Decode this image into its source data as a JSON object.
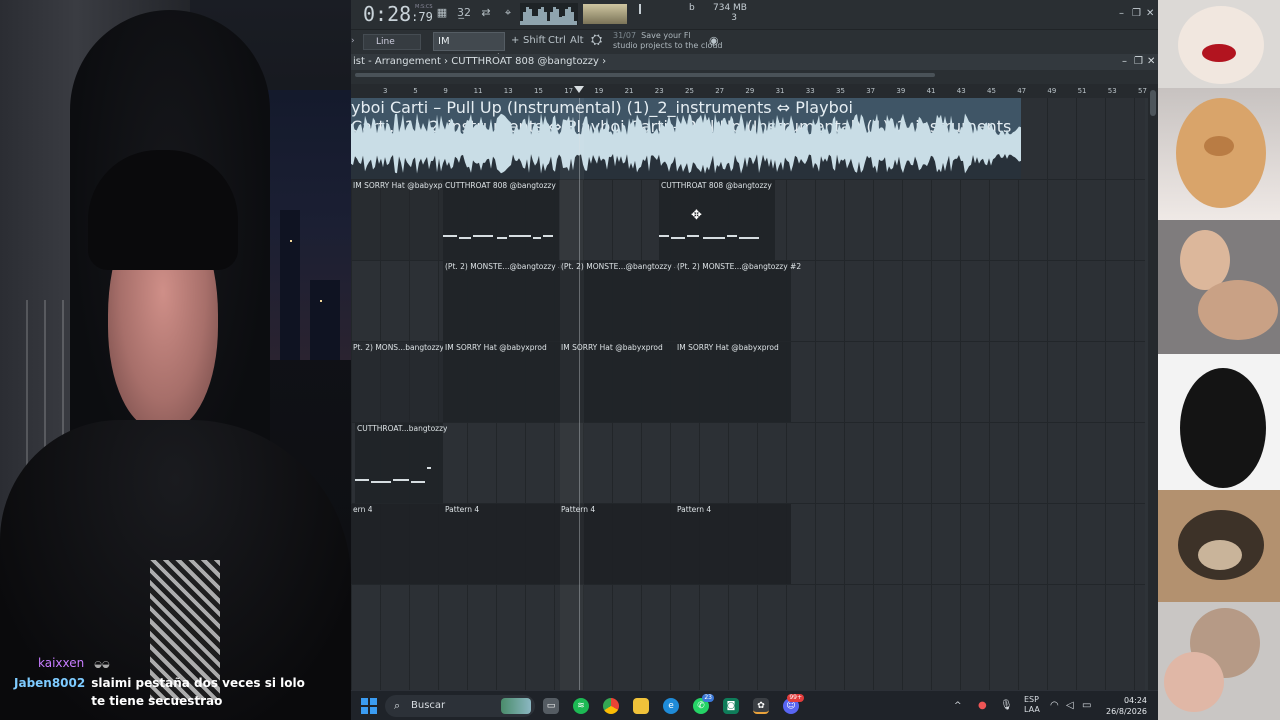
{
  "transport": {
    "time": "0:28",
    "time_ms": "79",
    "time_unit": "M:S:CS"
  },
  "stats": {
    "memory": "734 MB",
    "cpu_count": "3",
    "voices": "b"
  },
  "toolbar": {
    "snap_label": "Line",
    "pattern_selected": "IM SOR..yxprod",
    "modifier_shift": "Shift",
    "modifier_ctrl": "Ctrl",
    "modifier_alt": "Alt",
    "save_note_date": "31/07",
    "save_note_line1": "Save your Fl",
    "save_note_line2": "studio projects to the cloud"
  },
  "playlist": {
    "title": "ist - Arrangement › CUTTHROAT 808 @bangtozzy ›",
    "ruler_marks": [
      "3",
      "5",
      "9",
      "11",
      "13",
      "15",
      "17",
      "19",
      "21",
      "23",
      "25",
      "27",
      "29",
      "31",
      "33",
      "35",
      "37",
      "39",
      "41",
      "43",
      "45",
      "47",
      "49",
      "51",
      "53",
      "57"
    ],
    "audio_label": "yboi Carti – Pull Up (Instrumental) (1)_2_instruments ⇔ Playboi Carti...1)_2_instruments ⇔ Playboi Carti – Pull Up (Instrumental) (1)_2_instruments",
    "row2": [
      "IM SORRY Hat @babyxprod",
      "CUTTHROAT 808 @bangtozzy",
      "CUTTHROAT 808 @bangtozzy"
    ],
    "row3": [
      "(Pt. 2) MONSTE...@bangtozzy #2",
      "(Pt. 2) MONSTE...@bangtozzy #2",
      "(Pt. 2) MONSTE...@bangtozzy #2"
    ],
    "row4": [
      "Pt. 2) MONS...bangtozzy #2",
      "IM SORRY Hat @babyxprod",
      "IM SORRY Hat @babyxprod",
      "IM SORRY Hat @babyxprod"
    ],
    "row5": [
      "CUTTHROAT...bangtozzy"
    ],
    "row6": [
      "ern 4",
      "Pattern 4",
      "Pattern 4",
      "Pattern 4"
    ]
  },
  "chat": {
    "messages": [
      {
        "user": "kaixxen",
        "text": "",
        "color": "#c77dff"
      },
      {
        "user": "Jaben8002",
        "text": "slaimi pestaña dos veces si lolo te tiene secuestrao",
        "color": "#7ecbff"
      }
    ]
  },
  "taskbar": {
    "search_placeholder": "Buscar",
    "whatsapp_badge": "23",
    "discord_badge": "99+",
    "lang1": "ESP",
    "lang2": "LAA",
    "time": "04:24",
    "date": "26/8/2026"
  },
  "colors": {
    "accent": "#3b9cf2",
    "wave": "#c9dde6",
    "daw_bg": "#2e3338"
  }
}
